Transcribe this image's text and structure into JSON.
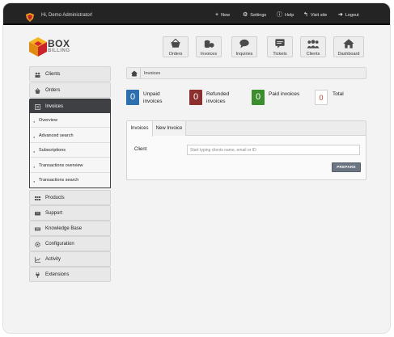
{
  "topbar": {
    "greeting": "Hi, Demo Administrator!",
    "links": [
      {
        "label": "New",
        "icon": "plus-icon"
      },
      {
        "label": "Settings",
        "icon": "gear-icon"
      },
      {
        "label": "Help",
        "icon": "info-icon"
      },
      {
        "label": "Visit site",
        "icon": "arrow-return-icon"
      },
      {
        "label": "Logout",
        "icon": "logout-arrow-icon"
      }
    ]
  },
  "logo": {
    "line1": "BOX",
    "line2": "BILLING"
  },
  "quicknav": [
    {
      "label": "Orders",
      "icon": "basket-icon"
    },
    {
      "label": "Invoices",
      "icon": "coins-icon"
    },
    {
      "label": "Inquiries",
      "icon": "speech-bubble-icon"
    },
    {
      "label": "Tickets",
      "icon": "ticket-bubble-icon"
    },
    {
      "label": "Clients",
      "icon": "users-icon"
    },
    {
      "label": "Dashboard",
      "icon": "house-icon"
    }
  ],
  "sidebar": {
    "items": [
      {
        "label": "Clients",
        "icon": "clients-icon"
      },
      {
        "label": "Orders",
        "icon": "basket-icon"
      },
      {
        "label": "Invoices",
        "icon": "invoice-icon",
        "active": true
      },
      {
        "label": "Products",
        "icon": "products-icon"
      },
      {
        "label": "Support",
        "icon": "support-icon"
      },
      {
        "label": "Knowledge Base",
        "icon": "book-icon"
      },
      {
        "label": "Configuration",
        "icon": "gear-icon"
      },
      {
        "label": "Activity",
        "icon": "chart-icon"
      },
      {
        "label": "Extensions",
        "icon": "plug-icon"
      }
    ],
    "subitems": [
      {
        "label": "Overview"
      },
      {
        "label": "Advanced search"
      },
      {
        "label": "Subscriptions"
      },
      {
        "label": "Transactions overview"
      },
      {
        "label": "Transactions search"
      }
    ]
  },
  "breadcrumb": {
    "current": "Invoices"
  },
  "stats": [
    {
      "count": "0",
      "label_line1": "Unpaid",
      "label_line2": "invoices",
      "color": "#2d6eaf"
    },
    {
      "count": "0",
      "label_line1": "Refunded",
      "label_line2": "invoices",
      "color": "#8b2f2f"
    },
    {
      "count": "0",
      "label_line1": "Paid invoices",
      "label_line2": "",
      "color": "#3c8d2e"
    },
    {
      "count": "0",
      "label_line1": "Total",
      "label_line2": "",
      "color": "#ffffff"
    }
  ],
  "panel": {
    "tabs": [
      "Invoices",
      "New Invoice"
    ],
    "client_label": "Client",
    "client_placeholder": "Start typing clients name, email or ID",
    "prepare_label": "PREPARE"
  }
}
